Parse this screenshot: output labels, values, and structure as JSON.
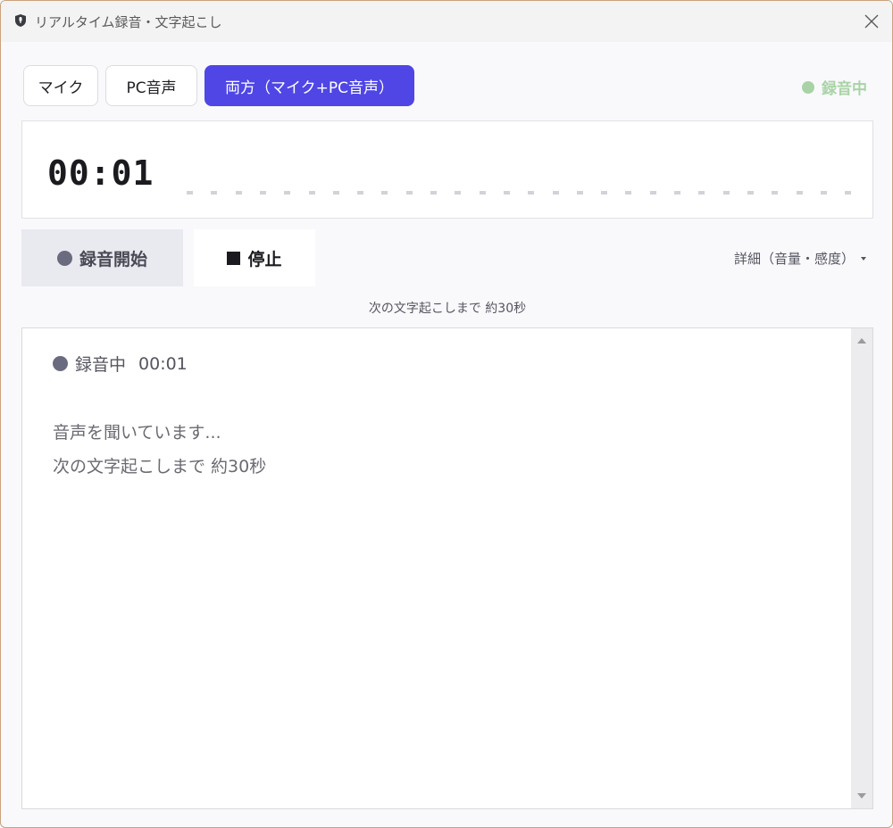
{
  "window": {
    "title": "リアルタイム録音・文字起こし",
    "icon": "microphone-shield-icon",
    "close_icon": "close-icon"
  },
  "source_tabs": [
    {
      "label": "マイク",
      "active": false
    },
    {
      "label": "PC音声",
      "active": false
    },
    {
      "label": "両方（マイク+PC音声）",
      "active": true
    }
  ],
  "recording_status": {
    "label": "● 録音中",
    "text": "録音中",
    "color": "#a9d3a6"
  },
  "timer": {
    "value": "00:01"
  },
  "controls": {
    "start_label": "録音開始",
    "stop_label": "停止",
    "detail_label": "詳細（音量・感度）",
    "detail_icon": "caret-down-icon"
  },
  "next_transcription_hint": "次の文字起こしまで 約30秒",
  "log": {
    "status_label": "録音中",
    "status_time": "00:01",
    "lines": [
      "音声を聞いています...",
      "次の文字起こしまで 約30秒"
    ]
  },
  "colors": {
    "accent": "#4f46e5",
    "recording": "#a9d3a6"
  }
}
